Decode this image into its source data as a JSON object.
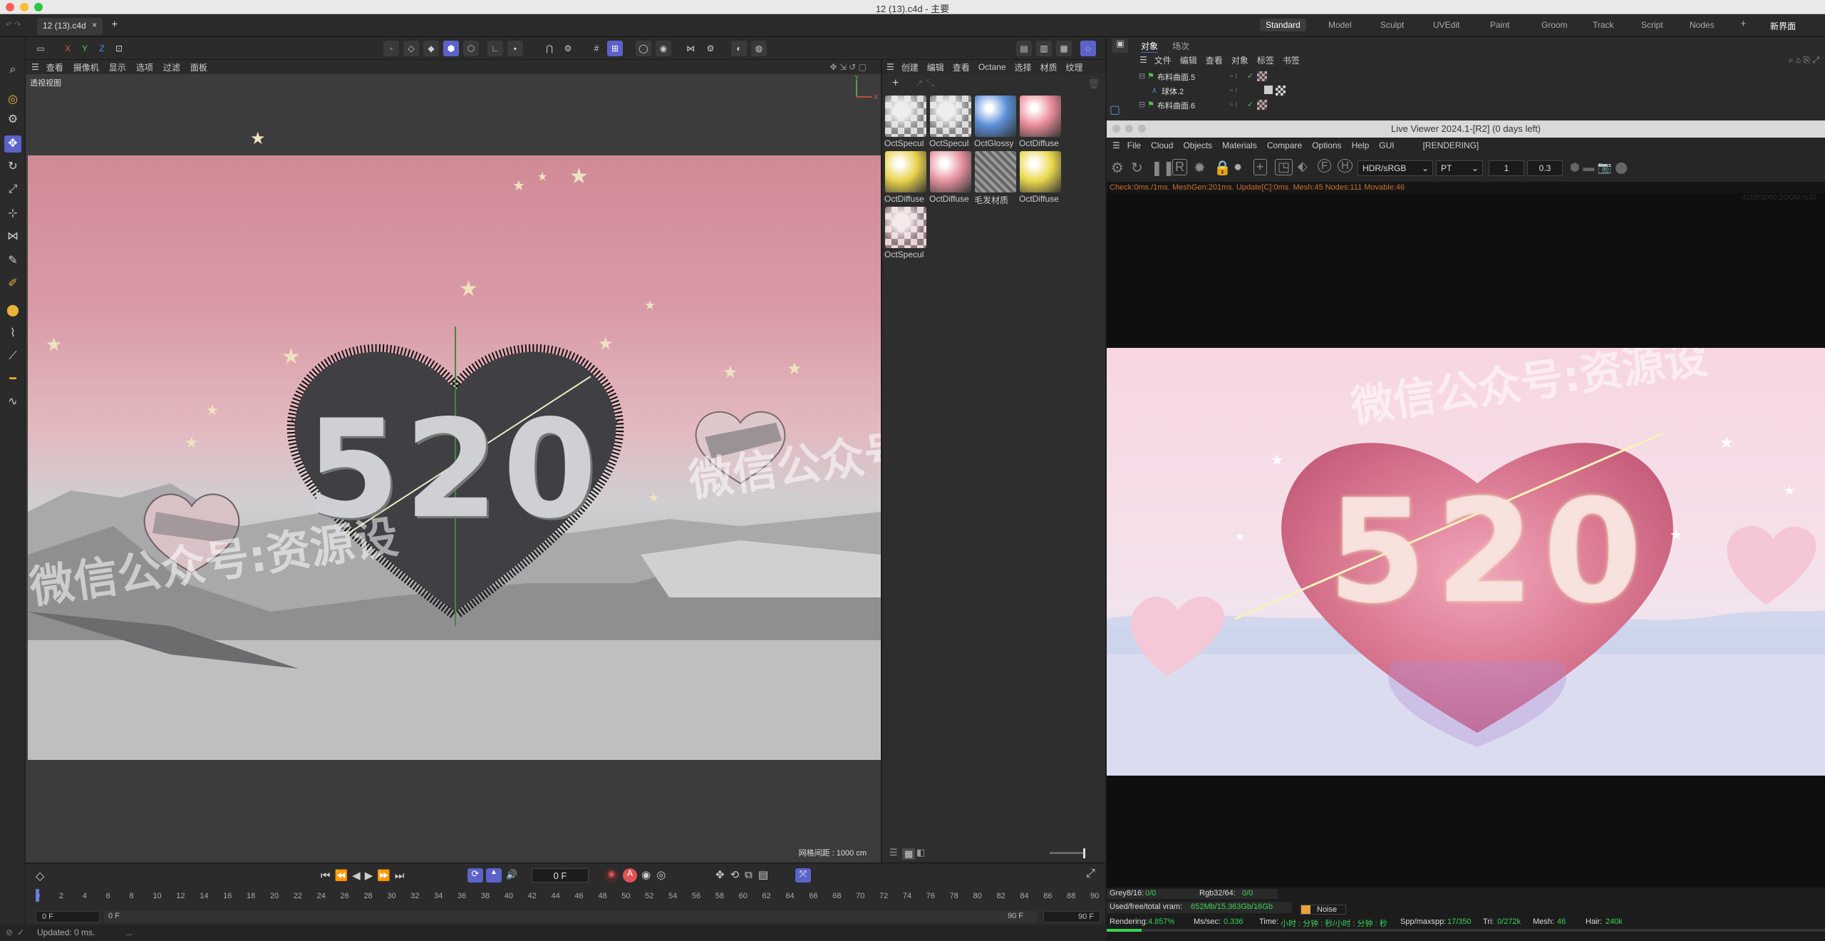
{
  "window": {
    "title": "12 (13).c4d - 主要"
  },
  "tabs": {
    "doc_tab": "12 (13).c4d",
    "close": "×",
    "add": "+"
  },
  "layouts": {
    "items": [
      "Standard",
      "Model",
      "Sculpt",
      "UVEdit",
      "Paint",
      "Groom",
      "Track",
      "Script",
      "Nodes"
    ],
    "add": "+",
    "new_layout": "新界面"
  },
  "axes_bar": {
    "x": "X",
    "y": "Y",
    "z": "Z"
  },
  "viewport": {
    "menu": [
      "查看",
      "摄像机",
      "显示",
      "选项",
      "过滤",
      "面板"
    ],
    "label": "透视视图",
    "grid_info": "网格间距 : 1000 cm",
    "scene_text": "520",
    "watermark": "微信公众号:资源设"
  },
  "materials": {
    "menu": [
      "创建",
      "编辑",
      "查看",
      "Octane",
      "选择",
      "材质",
      "纹理"
    ],
    "items": [
      {
        "name": "OctSpecul",
        "swatch": "checker"
      },
      {
        "name": "OctSpecul",
        "swatch": "checker"
      },
      {
        "name": "OctGlossy",
        "swatch": "#5b8fd8"
      },
      {
        "name": "OctDiffuse",
        "swatch": "#e98c99"
      },
      {
        "name": "OctDiffuse",
        "swatch": "#e9d34d"
      },
      {
        "name": "OctDiffuse",
        "swatch": "#e6929f"
      },
      {
        "name": "毛发材质",
        "swatch": "hair"
      },
      {
        "name": "OctDiffuse",
        "swatch": "#ead84d"
      },
      {
        "name": "OctSpecul",
        "swatch": "checker-pink"
      }
    ]
  },
  "objects": {
    "tabs": [
      "对象",
      "场次"
    ],
    "menu": [
      "文件",
      "编辑",
      "查看",
      "对象",
      "标签",
      "书签"
    ],
    "rows": [
      {
        "name": "布料曲面.5"
      },
      {
        "name": "球体.2"
      },
      {
        "name": "布料曲面.6"
      }
    ]
  },
  "live_viewer": {
    "title": "Live Viewer 2024.1-[R2] (0 days left)",
    "menu": [
      "File",
      "Cloud",
      "Objects",
      "Materials",
      "Compare",
      "Options",
      "Help",
      "GUI"
    ],
    "state": "[RENDERING]",
    "color_mode": "HDR/sRGB",
    "kernel": "PT",
    "value1": "1",
    "value2": "0.3",
    "stats": "Check:0ms./1ms. MeshGen:201ms. Update[C]:0ms. Mesh:45 Nodes:111 Movable:46",
    "resolution": "4200*3000 ZOOM:%30",
    "render_text": "520",
    "watermark": "微信公众号:资源设"
  },
  "lv_bottom": {
    "grey_label": "Grey8/16:",
    "grey_val": "0/0",
    "rgb_label": "Rgb32/64:",
    "rgb_val": "0/0",
    "vram_label": "Used/free/total vram:",
    "vram_val": "652Mb/15.363Gb/16Gb",
    "noise": "Noise",
    "rendering_label": "Rendering:",
    "rendering_val": "4.857%",
    "ms_label": "Ms/sec:",
    "ms_val": "0.336",
    "time_label": "Time:",
    "time_val": "小时 : 分钟 : 秒/小时 : 分钟 : 秒",
    "spp_label": "Spp/maxspp:",
    "spp_val": "17/350",
    "tri_label": "Tri:",
    "tri_val": "0/272k",
    "mesh_label": "Mesh:",
    "mesh_val": "46",
    "hair_label": "Hair:",
    "hair_val": "240k",
    "progress": 0.04857
  },
  "timeline": {
    "frame": "0 F",
    "start": "0 F",
    "start2": "0 F",
    "end": "90 F",
    "end2": "90 F",
    "ticks": [
      "0",
      "2",
      "4",
      "6",
      "8",
      "10",
      "12",
      "14",
      "16",
      "18",
      "20",
      "22",
      "24",
      "26",
      "28",
      "30",
      "32",
      "34",
      "36",
      "38",
      "40",
      "42",
      "44",
      "46",
      "48",
      "50",
      "52",
      "54",
      "56",
      "58",
      "60",
      "62",
      "64",
      "66",
      "68",
      "70",
      "72",
      "74",
      "76",
      "78",
      "80",
      "82",
      "84",
      "86",
      "88",
      "90"
    ]
  },
  "status": {
    "text": "Updated: 0 ms.",
    "extra": "..."
  },
  "colors": {
    "accent": "#5b63c9",
    "stats_orange": "#c86f2f",
    "stat_green": "#39d353"
  }
}
